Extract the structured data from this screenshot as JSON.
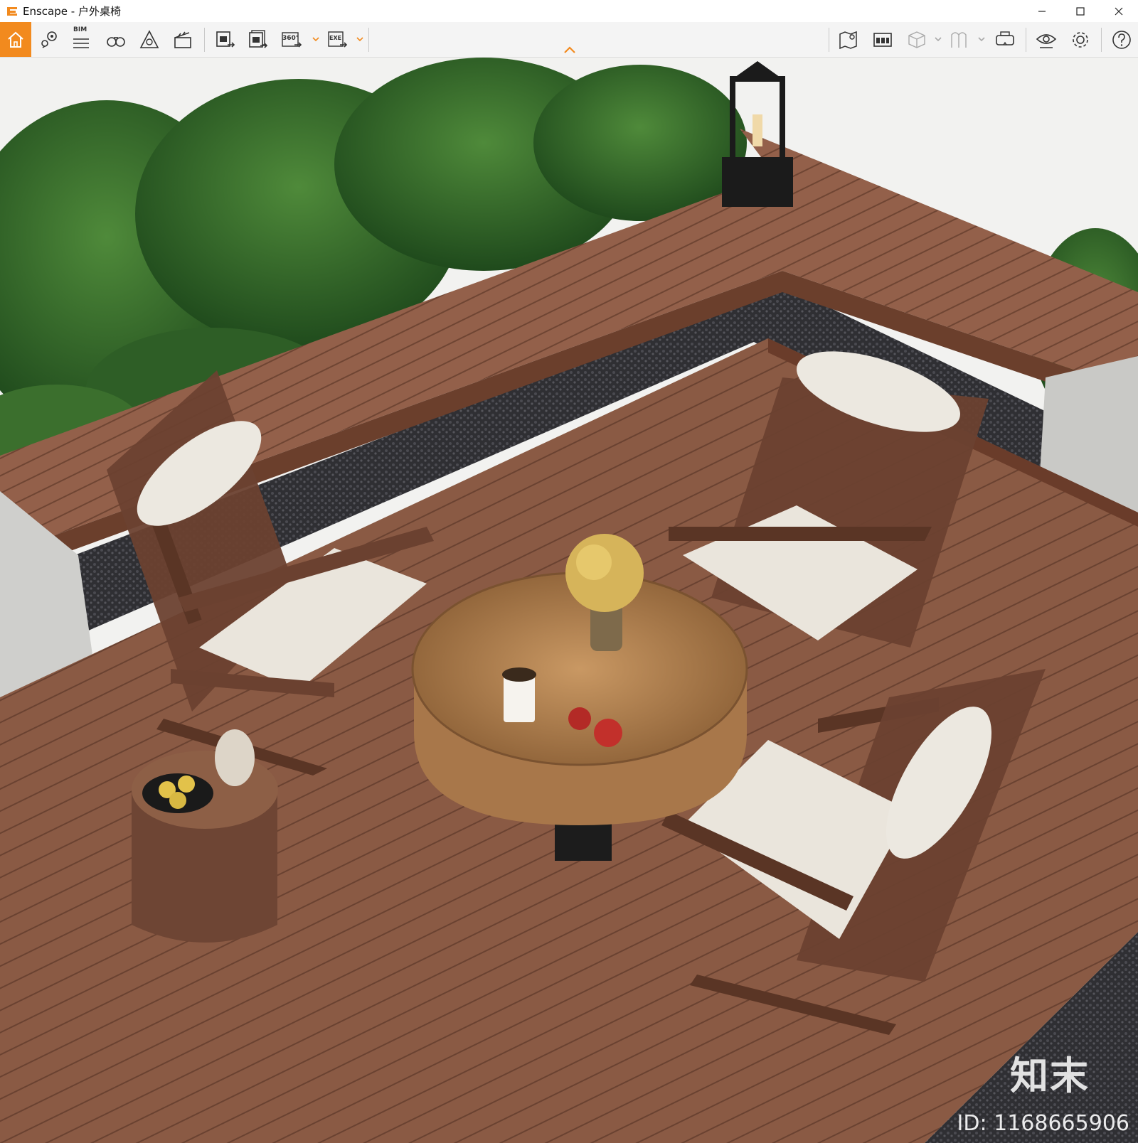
{
  "window": {
    "app_name": "Enscape",
    "separator": " - ",
    "document_title": "户外桌椅",
    "controls": [
      "minimize",
      "maximize",
      "close"
    ]
  },
  "toolbar": {
    "left_icons": [
      "home-icon",
      "map-pin-icon",
      "bim-icon",
      "binoculars-icon",
      "render-settings-icon",
      "clapper-icon",
      "export-image-icon",
      "batch-export-icon",
      "export-360-icon",
      "export-exe-icon"
    ],
    "bim_label": "BIM",
    "export_360_label": "360°",
    "export_exe_label": "EXE",
    "right_icons": [
      "map-icon",
      "asset-library-icon",
      "cube-icon",
      "material-icon",
      "vr-headset-icon",
      "eye-icon",
      "settings-icon",
      "help-icon"
    ],
    "accent_color": "#f28a1e"
  },
  "viewport": {
    "scene": "outdoor wooden deck with three chairs, round wooden coffee table, stump side table, planter with tropical plants, black lantern",
    "watermark_brand": "知末",
    "watermark_id": "ID: 1168665906"
  }
}
